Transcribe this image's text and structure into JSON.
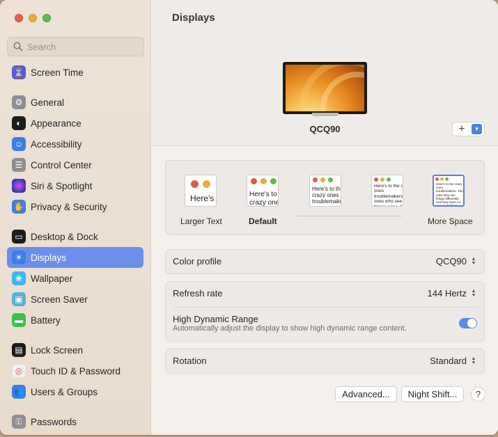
{
  "window": {
    "title": "Displays"
  },
  "search": {
    "placeholder": "Search"
  },
  "sidebar": {
    "items": [
      {
        "label": "Screen Time",
        "icon": "hourglass-icon",
        "color": "#5b5bd6"
      },
      {
        "label": "General",
        "icon": "gear-icon",
        "color": "#8e8e93"
      },
      {
        "label": "Appearance",
        "icon": "appearance-icon",
        "color": "#1c1c1e"
      },
      {
        "label": "Accessibility",
        "icon": "accessibility-icon",
        "color": "#3d7ee6"
      },
      {
        "label": "Control Center",
        "icon": "control-center-icon",
        "color": "#8e8e93"
      },
      {
        "label": "Siri & Spotlight",
        "icon": "siri-icon",
        "color": "#6d3bd1"
      },
      {
        "label": "Privacy & Security",
        "icon": "hand-icon",
        "color": "#3d7ee6"
      },
      {
        "label": "Desktop & Dock",
        "icon": "dock-icon",
        "color": "#1c1c1e"
      },
      {
        "label": "Displays",
        "icon": "sun-icon",
        "color": "#3d7ee6"
      },
      {
        "label": "Wallpaper",
        "icon": "flower-icon",
        "color": "#3fb6e8"
      },
      {
        "label": "Screen Saver",
        "icon": "screen-saver-icon",
        "color": "#5ab0d8"
      },
      {
        "label": "Battery",
        "icon": "battery-icon",
        "color": "#3fbf4f"
      },
      {
        "label": "Lock Screen",
        "icon": "lock-screen-icon",
        "color": "#1c1c1e"
      },
      {
        "label": "Touch ID & Password",
        "icon": "fingerprint-icon",
        "color": "#f2f2f2"
      },
      {
        "label": "Users & Groups",
        "icon": "users-icon",
        "color": "#3d7ee6"
      },
      {
        "label": "Passwords",
        "icon": "key-icon",
        "color": "#8e8e93"
      }
    ],
    "active": "Displays"
  },
  "main": {
    "title": "Displays",
    "monitor_name": "QCQ90",
    "add_label": "+",
    "resolution_options": [
      {
        "label": "Larger Text",
        "sample": "Here's"
      },
      {
        "label": "Default",
        "sample": "Here's to the crazy ones troublemakers"
      },
      {
        "label": "",
        "sample": "Here's to the crazy ones troublemakers ones who see"
      },
      {
        "label": "",
        "sample": "Here's to the crazy ones troublemakers. ones who see things rules. And they"
      },
      {
        "label": "More Space",
        "sample": "Here's to the crazy ones troublemakers. The ones who see things differently. And they have no can quote them, disagree about them. Because they change"
      }
    ],
    "color_profile": {
      "label": "Color profile",
      "value": "QCQ90"
    },
    "refresh_rate": {
      "label": "Refresh rate",
      "value": "144 Hertz"
    },
    "hdr": {
      "label": "High Dynamic Range",
      "description": "Automatically adjust the display to show high dynamic range content.",
      "enabled": true
    },
    "rotation": {
      "label": "Rotation",
      "value": "Standard"
    },
    "buttons": {
      "advanced": "Advanced...",
      "night_shift": "Night Shift...",
      "help": "?"
    }
  }
}
